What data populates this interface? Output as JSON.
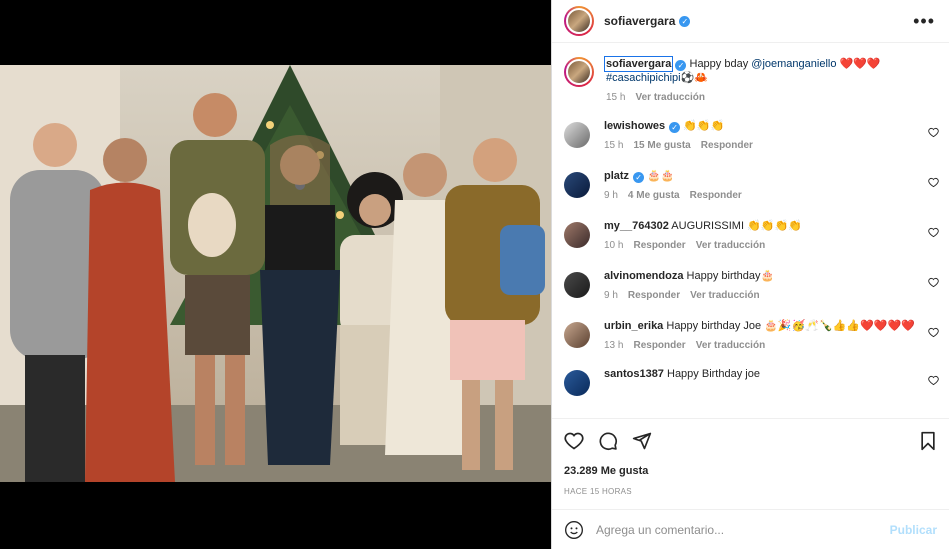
{
  "post": {
    "username": "sofiavergara",
    "caption": "Happy bday",
    "mention": "@joemanganiello",
    "hearts": "❤️❤️❤️",
    "hashtag": "#casachipichipi",
    "caption_emojis": "⚽🦀",
    "time": "15 h",
    "translate": "Ver traducción",
    "likes": "23.289 Me gusta",
    "posted": "HACE 15 HORAS"
  },
  "comments": [
    {
      "user": "lewishowes",
      "verified": true,
      "text": "👏👏👏",
      "time": "15 h",
      "likes": "15 Me gusta",
      "reply": "Responder",
      "translate": ""
    },
    {
      "user": "platz",
      "verified": true,
      "text": "🎂🎂",
      "time": "9 h",
      "likes": "4 Me gusta",
      "reply": "Responder",
      "translate": ""
    },
    {
      "user": "my__764302",
      "verified": false,
      "text": "AUGURISSIMI 👏👏👏👏",
      "time": "10 h",
      "likes": "",
      "reply": "Responder",
      "translate": "Ver traducción"
    },
    {
      "user": "alvinomendoza",
      "verified": false,
      "text": "Happy birthday🎂",
      "time": "9 h",
      "likes": "",
      "reply": "Responder",
      "translate": "Ver traducción"
    },
    {
      "user": "urbin_erika",
      "verified": false,
      "text": "Happy birthday Joe 🎂🎉🥳🥂🍾👍👍❤️❤️❤️❤️",
      "time": "13 h",
      "likes": "",
      "reply": "Responder",
      "translate": "Ver traducción"
    },
    {
      "user": "santos1387",
      "verified": false,
      "text": "Happy Birthday joe",
      "time": "",
      "likes": "",
      "reply": "",
      "translate": ""
    }
  ],
  "composer": {
    "placeholder": "Agrega un comentario...",
    "publish": "Publicar"
  },
  "icons": [
    "more-icon",
    "heart-icon",
    "comment-icon",
    "share-icon",
    "bookmark-icon",
    "emoji-icon"
  ],
  "colors": {
    "link": "#00376b",
    "verified": "#3897f0",
    "publish_disabled": "#b2dffc",
    "muted": "#8e8e8e"
  }
}
